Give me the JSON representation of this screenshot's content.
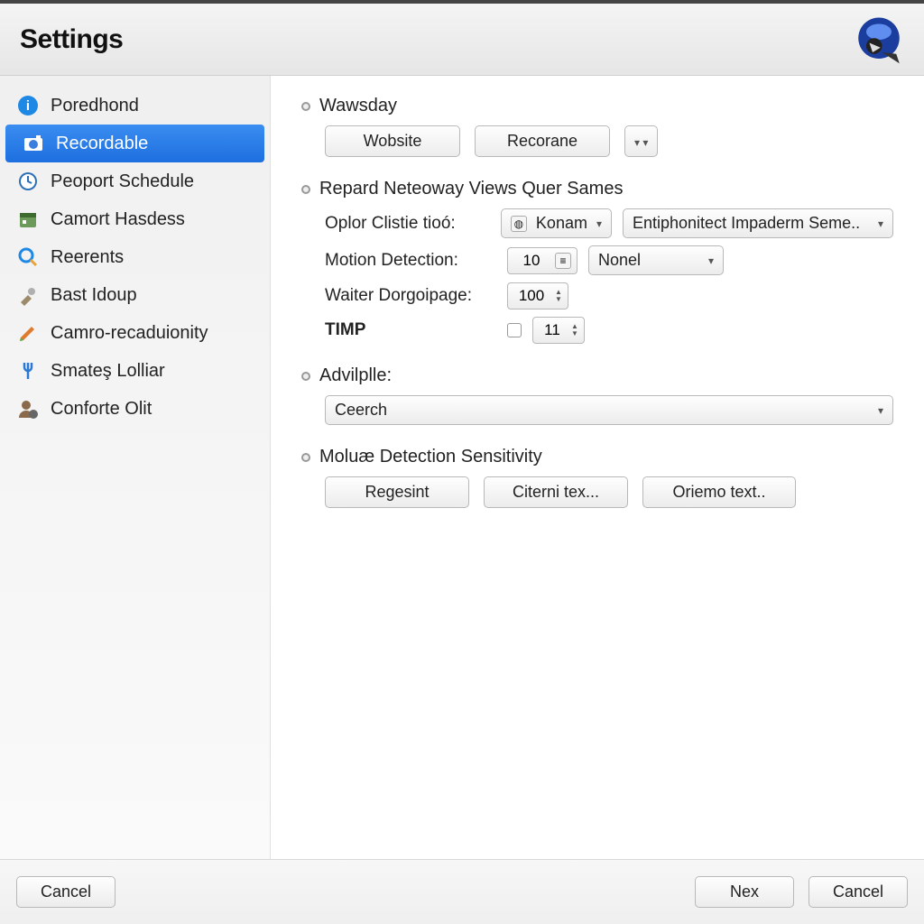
{
  "header": {
    "title": "Settings"
  },
  "sidebar": {
    "items": [
      {
        "name": "poredhond",
        "label": "Poredhond",
        "icon": "info"
      },
      {
        "name": "recordable",
        "label": "Recordable",
        "icon": "camera",
        "selected": true
      },
      {
        "name": "peoport-schedule",
        "label": "Peoport Schedule",
        "icon": "clock"
      },
      {
        "name": "camort-hasdess",
        "label": "Camort Hasdess",
        "icon": "calendar"
      },
      {
        "name": "reerents",
        "label": "Reerents",
        "icon": "search"
      },
      {
        "name": "bast-idoup",
        "label": "Bast Idoup",
        "icon": "tools"
      },
      {
        "name": "camro-recaduionity",
        "label": "Camro-recaduionity",
        "icon": "pencil"
      },
      {
        "name": "smates-lolliar",
        "label": "Smateş Lolliar",
        "icon": "fork"
      },
      {
        "name": "conforte-olit",
        "label": "Conforte Olit",
        "icon": "user"
      }
    ]
  },
  "sections": {
    "wawsday": {
      "title": "Wawsday",
      "buttons": {
        "wobsite": "Wobsite",
        "recorane": "Recorane"
      }
    },
    "repard": {
      "title": "Repard Neteoway Views Quer Sames",
      "oplor_label": "Oplor Clistie tioó:",
      "oplor_value": "Konam",
      "oplor_secondary": "Entiphonitect Impaderm Seme..",
      "motion_label": "Motion Detection:",
      "motion_number": "10",
      "motion_select": "Nonel",
      "waiter_label": "Waiter Dorgoipage:",
      "waiter_value": "100",
      "timp_label": "TIMP",
      "timp_value": "11"
    },
    "advilplle": {
      "title": "Advilplle:",
      "value": "Ceerch"
    },
    "motion_sens": {
      "title": "Moluæ Detection Sensitivity",
      "buttons": {
        "regesint": "Regesint",
        "citerni": "Citerni tex...",
        "oriemo": "Oriemo text.."
      }
    }
  },
  "footer": {
    "cancel_left": "Cancel",
    "next": "Nex",
    "cancel_right": "Cancel"
  }
}
